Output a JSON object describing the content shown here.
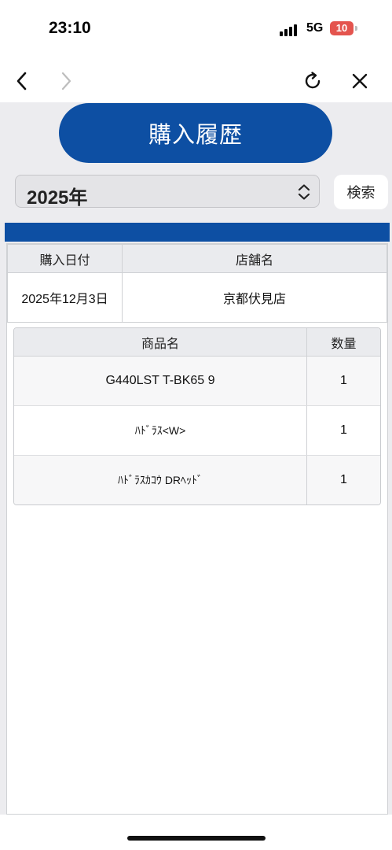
{
  "status_bar": {
    "time": "23:10",
    "network": "5G",
    "battery": "10"
  },
  "browser": {
    "back_icon": "chevron-left-icon",
    "forward_icon": "chevron-right-icon",
    "reload_icon": "reload-icon",
    "close_icon": "close-icon"
  },
  "page": {
    "title": "購入履歴",
    "year_select": {
      "value": "2025年"
    },
    "search_label": "検索",
    "accent_color": "#0d4fa3"
  },
  "purchase": {
    "headers": {
      "date": "購入日付",
      "store": "店舗名"
    },
    "date": "2025年12月3日",
    "store": "京都伏見店"
  },
  "items": {
    "headers": {
      "name": "商品名",
      "qty": "数量"
    },
    "rows": [
      {
        "name": "G440LST T-BK65 9",
        "qty": "1"
      },
      {
        "name": "ﾊﾄﾞﾗｽ<W>",
        "qty": "1"
      },
      {
        "name": "ﾊﾄﾞﾗｽｶｺｳ DRﾍｯﾄﾞ",
        "qty": "1"
      }
    ]
  }
}
